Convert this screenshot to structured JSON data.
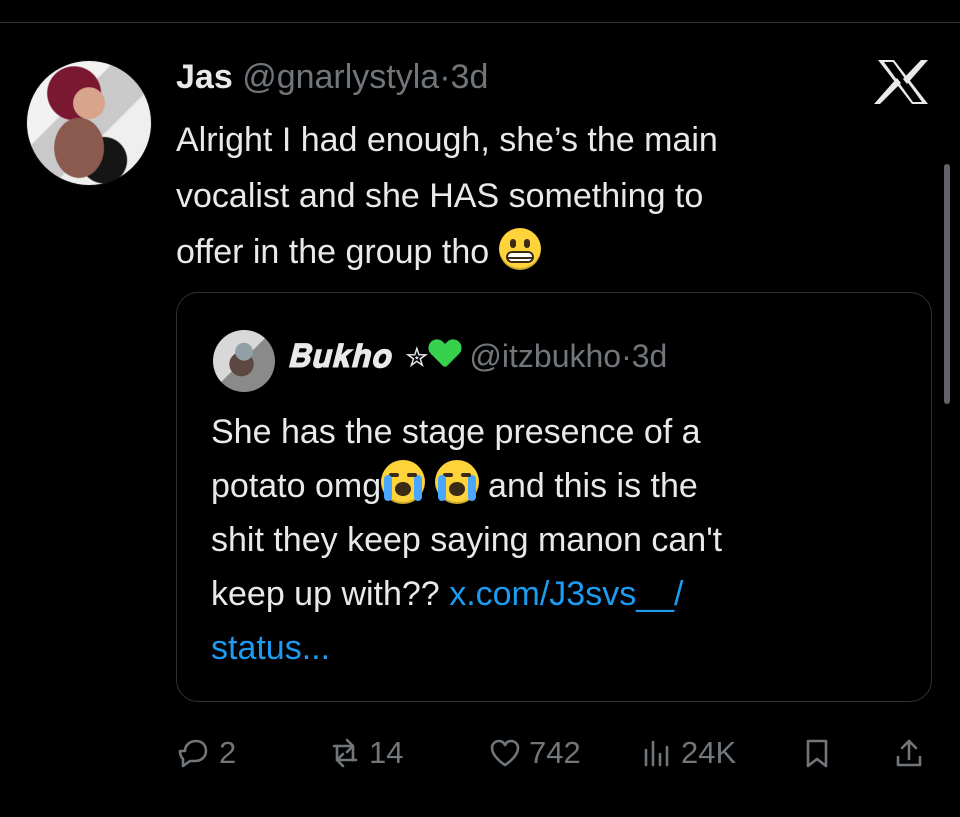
{
  "tweet": {
    "author_name": "Jas",
    "author_handle": "@gnarlystyla",
    "dot": "·",
    "time": "3d",
    "text_lines": [
      "Alright I had enough, she’s the main",
      "vocalist and she HAS something to",
      "offer in the group tho"
    ],
    "emoji": "grimacing-face-emoji",
    "platform_icon": "x-logo-icon"
  },
  "quote": {
    "author_name": "𝐁𝐮𝐤𝐡𝐨",
    "star": "✮",
    "heart": "green-heart-icon",
    "author_handle": "@itzbukho",
    "dot": "·",
    "time": "3d",
    "text_lines": [
      "She has the stage presence of a",
      "potato omg",
      "and this is the",
      "shit they keep saying manon can't",
      "keep up with??",
      "x.com/J3svs__/",
      "status..."
    ],
    "emojis": [
      "loudly-crying-face-emoji",
      "loudly-crying-face-emoji"
    ],
    "link_color": "#1d9bf0"
  },
  "actions": {
    "replies": "2",
    "reposts": "14",
    "likes": "742",
    "views": "24K",
    "icons": [
      "reply-icon",
      "repost-icon",
      "like-icon",
      "views-icon",
      "bookmark-icon",
      "share-icon"
    ]
  },
  "colors": {
    "background": "#000000",
    "text": "#e7e9ea",
    "muted": "#71767b",
    "border": "#2f3336"
  }
}
